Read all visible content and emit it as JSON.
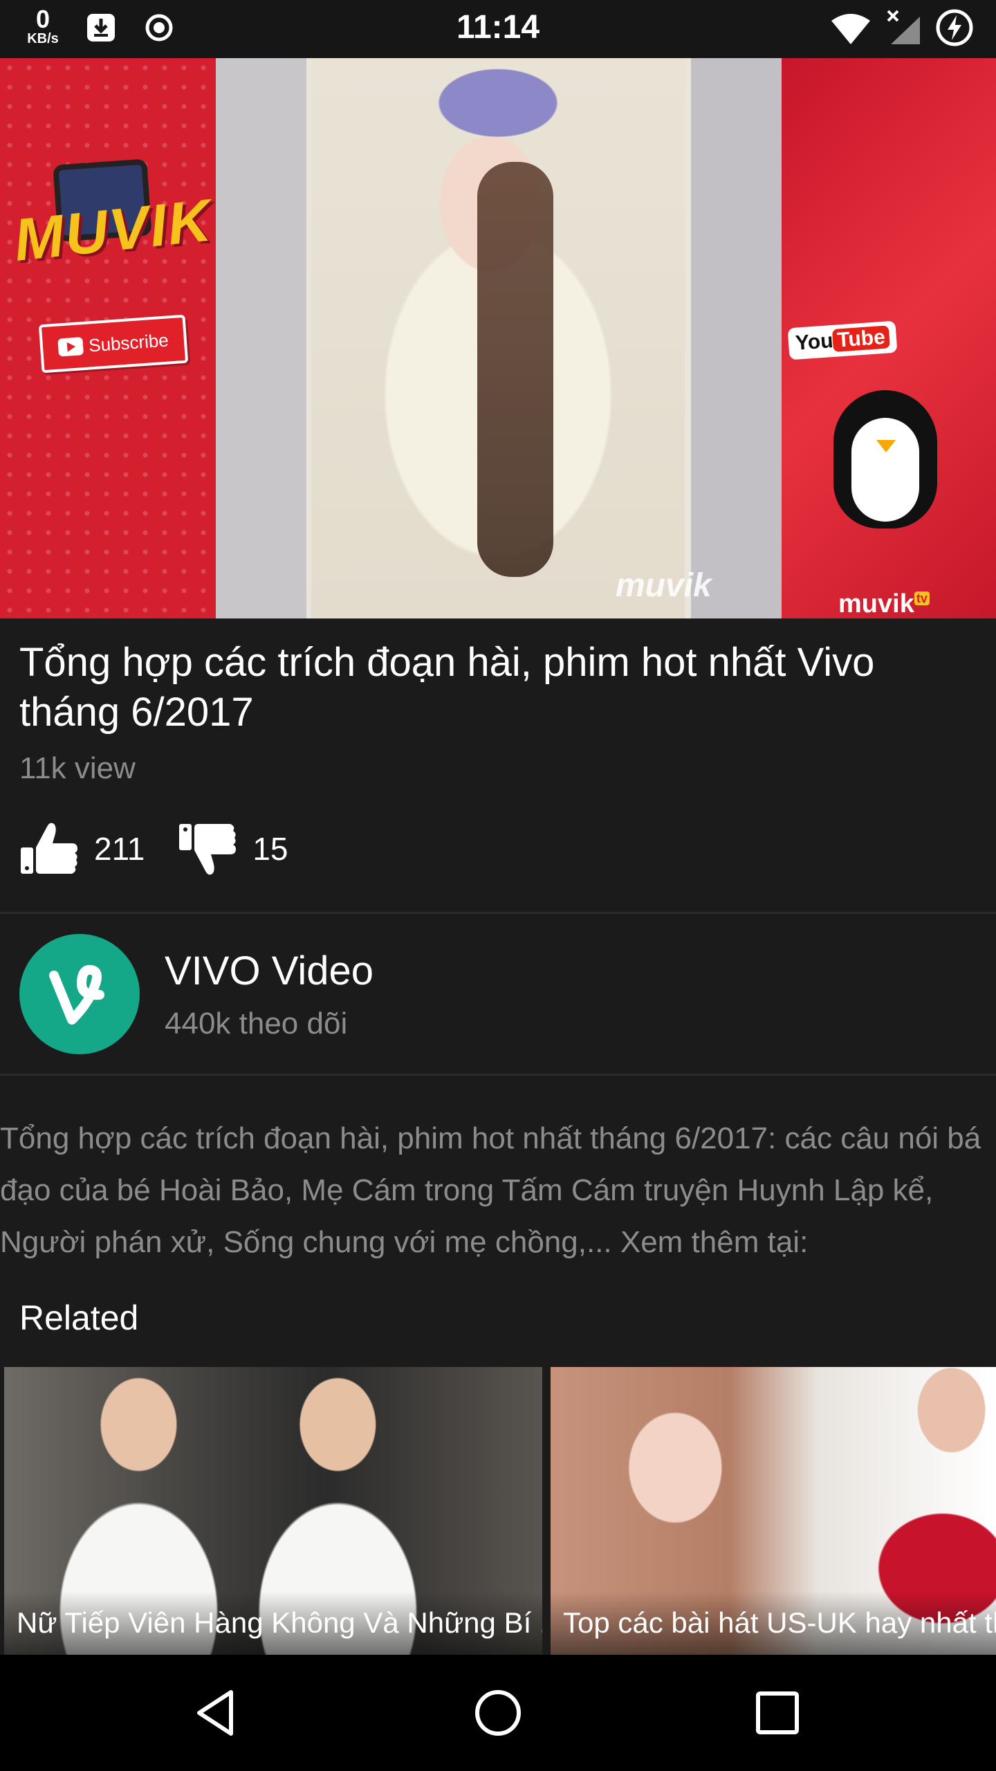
{
  "status_bar": {
    "speed_value": "0",
    "speed_unit": "KB/s",
    "time": "11:14"
  },
  "video": {
    "left_brand": "MUVIK",
    "subscribe_label": "Subscribe",
    "youtube_badge_you": "You",
    "youtube_badge_tube": "Tube",
    "right_brand": "muvik",
    "right_brand_sup": "tv",
    "watermark": "muvik"
  },
  "details": {
    "title": "Tổng hợp các trích đoạn hài, phim hot nhất Vivo tháng 6/2017",
    "views": "11k view",
    "likes": "211",
    "dislikes": "15"
  },
  "channel": {
    "name": "VIVO Video",
    "followers": "440k theo dõi"
  },
  "description": "Tổng hợp các trích đoạn hài, phim hot nhất tháng 6/2017: các câu nói bá đạo của bé Hoài Bảo, Mẹ Cám trong Tấm Cám truyện Huynh Lập kể, Người phán xử, Sống chung với mẹ chồng,... Xem thêm tại:",
  "related": {
    "label": "Related",
    "items": [
      {
        "title": "Nữ Tiếp Viên Hàng Không Và Những Bí .."
      },
      {
        "title": "Top các bài hát US-UK hay nhất tha"
      }
    ]
  },
  "colors": {
    "background": "#1b1b1b",
    "accent_channel": "#14a889",
    "muted_text": "#8c8c8c"
  }
}
